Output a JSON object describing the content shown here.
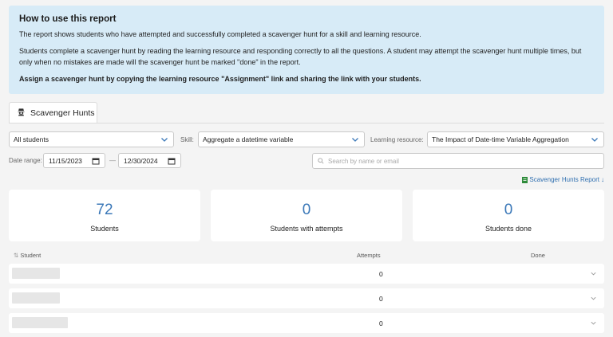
{
  "info": {
    "title": "How to use this report",
    "p1": "The report shows students who have attempted and successfully completed a scavenger hunt for a skill and learning resource.",
    "p2": "Students complete a scavenger hunt by reading the learning resource and responding correctly to all the questions. A student may attempt the scavenger hunt multiple times, but only when no mistakes are made will the scavenger hunt be marked \"done\" in the report.",
    "p3": "Assign a scavenger hunt by copying the learning resource \"Assignment\" link and sharing the link with your students."
  },
  "tab": {
    "label": "Scavenger Hunts",
    "icon": "spy-icon"
  },
  "filters": {
    "students": "All students",
    "skill_label": "Skill:",
    "skill": "Aggregate a datetime variable",
    "resource_label": "Learning resource:",
    "resource": "The Impact of Date-time Variable Aggregation",
    "date_label": "Date range:",
    "date_from": "11/15/2023",
    "date_sep": "—",
    "date_to": "12/30/2024",
    "search_placeholder": "Search by name or email"
  },
  "report_link": "Scavenger Hunts Report",
  "stats": [
    {
      "value": "72",
      "label": "Students"
    },
    {
      "value": "0",
      "label": "Students with attempts"
    },
    {
      "value": "0",
      "label": "Students done"
    }
  ],
  "table": {
    "col_student": "Student",
    "col_attempts": "Attempts",
    "col_done": "Done",
    "rows": [
      {
        "attempts": "0"
      },
      {
        "attempts": "0"
      },
      {
        "attempts": "0"
      }
    ]
  },
  "colors": {
    "accent": "#3b78b8",
    "info_bg": "#d7ebf7",
    "link": "#2f6fb0"
  }
}
